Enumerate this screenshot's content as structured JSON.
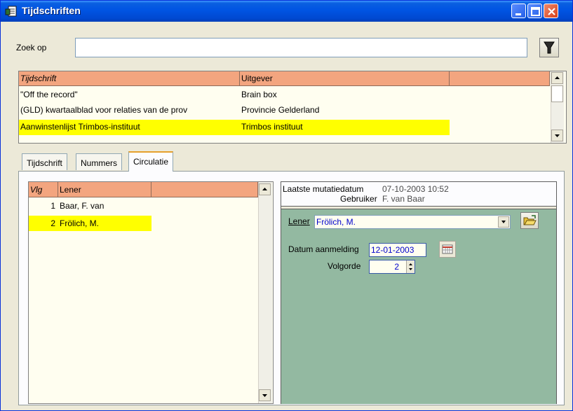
{
  "window": {
    "title": "Tijdschriften"
  },
  "search": {
    "label": "Zoek op",
    "value": ""
  },
  "journals_grid": {
    "headers": [
      "Tijdschrift",
      "Uitgever"
    ],
    "rows": [
      {
        "tijdschrift": "\"Off the record\"",
        "uitgever": "Brain box"
      },
      {
        "tijdschrift": "(GLD) kwartaalblad voor relaties van de prov",
        "uitgever": "Provincie Gelderland"
      },
      {
        "tijdschrift": "Aanwinstenlijst Trimbos-instituut",
        "uitgever": "Trimbos instituut"
      }
    ],
    "selected_index": 2
  },
  "tabs": [
    {
      "label": "Tijdschrift"
    },
    {
      "label": "Nummers"
    },
    {
      "label": "Circulatie"
    }
  ],
  "active_tab": 2,
  "circulation_grid": {
    "headers": [
      "Vlg",
      "Lener"
    ],
    "rows": [
      {
        "vlg": "1",
        "lener": "Baar, F. van"
      },
      {
        "vlg": "2",
        "lener": "Frölich, M."
      }
    ],
    "selected_index": 1
  },
  "detail": {
    "mutatie_label": "Laatste mutatiedatum",
    "mutatie_value": "07-10-2003 10:52",
    "gebruiker_label": "Gebruiker",
    "gebruiker_value": "F. van Baar",
    "lener_label": "Lener",
    "lener_value": "Frölich, M.",
    "datum_label": "Datum aanmelding",
    "datum_value": "12-01-2003",
    "volgorde_label": "Volgorde",
    "volgorde_value": "2"
  },
  "colors": {
    "header_bg": "#f3a57f",
    "selection": "#ffff00",
    "panel_green": "#93b9a1",
    "title_blue": "#0054e3"
  },
  "icons": [
    "app-icon",
    "minimize-icon",
    "maximize-icon",
    "close-icon",
    "funnel-filter-icon",
    "folder-open-icon",
    "calendar-icon",
    "chevron-down-icon",
    "arrow-up-icon",
    "arrow-down-icon"
  ]
}
